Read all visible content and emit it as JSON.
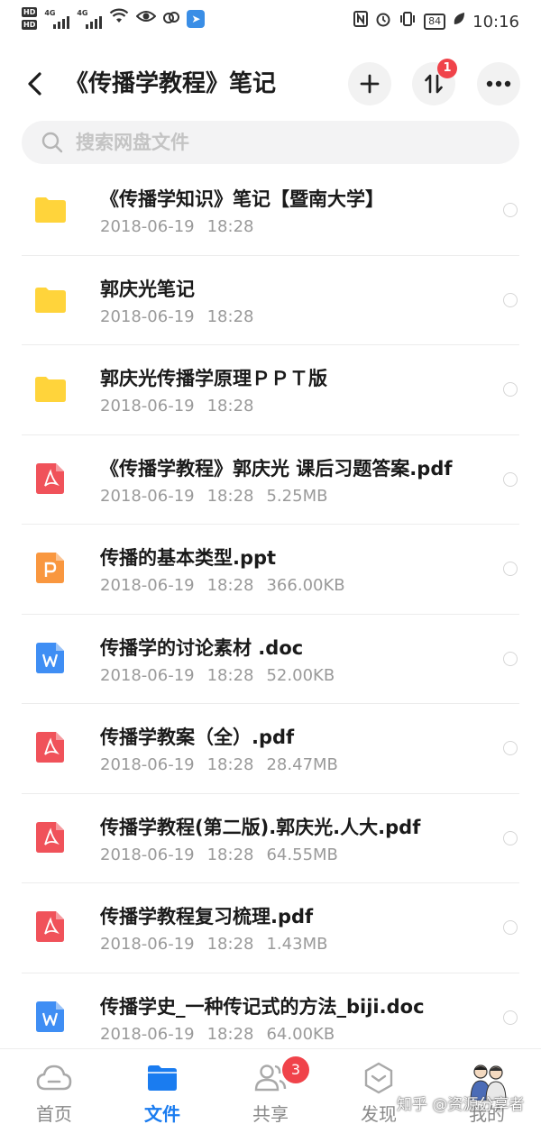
{
  "status_bar": {
    "hd1": "HD",
    "hd2": "HD",
    "net1": "4G",
    "net2": "4G",
    "battery": "84",
    "time": "10:16"
  },
  "header": {
    "title": "《传播学教程》笔记",
    "sort_badge": "1"
  },
  "search": {
    "placeholder": "搜索网盘文件"
  },
  "files": [
    {
      "name": "《传播学知识》笔记【暨南大学】",
      "date": "2018-06-19",
      "time": "18:28",
      "size": "",
      "type": "folder"
    },
    {
      "name": "郭庆光笔记",
      "date": "2018-06-19",
      "time": "18:28",
      "size": "",
      "type": "folder"
    },
    {
      "name": "郭庆光传播学原理ＰＰＴ版",
      "date": "2018-06-19",
      "time": "18:28",
      "size": "",
      "type": "folder"
    },
    {
      "name": "《传播学教程》郭庆光 课后习题答案.pdf",
      "date": "2018-06-19",
      "time": "18:28",
      "size": "5.25MB",
      "type": "pdf"
    },
    {
      "name": "传播的基本类型.ppt",
      "date": "2018-06-19",
      "time": "18:28",
      "size": "366.00KB",
      "type": "ppt"
    },
    {
      "name": "传播学的讨论素材 .doc",
      "date": "2018-06-19",
      "time": "18:28",
      "size": "52.00KB",
      "type": "doc"
    },
    {
      "name": "传播学教案（全）.pdf",
      "date": "2018-06-19",
      "time": "18:28",
      "size": "28.47MB",
      "type": "pdf"
    },
    {
      "name": "传播学教程(第二版).郭庆光.人大.pdf",
      "date": "2018-06-19",
      "time": "18:28",
      "size": "64.55MB",
      "type": "pdf"
    },
    {
      "name": "传播学教程复习梳理.pdf",
      "date": "2018-06-19",
      "time": "18:28",
      "size": "1.43MB",
      "type": "pdf"
    },
    {
      "name": "传播学史_一种传记式的方法_biji.doc",
      "date": "2018-06-19",
      "time": "18:28",
      "size": "64.00KB",
      "type": "doc"
    }
  ],
  "nav": {
    "home": "首页",
    "files": "文件",
    "share": "共享",
    "share_badge": "3",
    "discover": "发现",
    "mine": "我的"
  },
  "watermark": "知乎 @资源分享者",
  "colors": {
    "accent": "#1a7cf0",
    "folder": "#ffd43b",
    "pdf": "#f0525a",
    "ppt": "#f9973f",
    "doc": "#3f8ef4",
    "badge": "#f0434a"
  }
}
